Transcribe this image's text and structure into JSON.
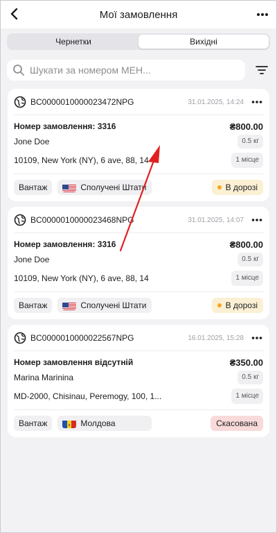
{
  "header": {
    "title": "Мої замовлення"
  },
  "tabs": [
    {
      "label": "Чернетки",
      "active": false
    },
    {
      "label": "Вихідні",
      "active": true
    }
  ],
  "search": {
    "placeholder": "Шукати за номером МЕН...",
    "value": ""
  },
  "colors": {
    "accent_arrow": "#e02020",
    "transit_bg": "#fbf0d4",
    "cancel_bg": "#f9dada"
  },
  "orders": [
    {
      "code": "BC0000010000023472NPG",
      "date": "31.01.2025, 14:24",
      "order_label": "Номер замовлення: 3316",
      "price": "₴800.00",
      "recipient": "Jone Doe",
      "weight": "0.5 кг",
      "address": "10109, New York (NY), 6 ave, 88, 14",
      "places": "1 місце",
      "type": "Вантаж",
      "country": "Сполучені Штати Америки",
      "country_flag": "us-flag-icon",
      "status": "В дорозі",
      "status_kind": "transit"
    },
    {
      "code": "BC0000010000023468NPG",
      "date": "31.01.2025, 14:07",
      "order_label": "Номер замовлення: 3316",
      "price": "₴800.00",
      "recipient": "Jone Doe",
      "weight": "0.5 кг",
      "address": "10109, New York (NY), 6 ave, 88, 14",
      "places": "1 місце",
      "type": "Вантаж",
      "country": "Сполучені Штати Америки",
      "country_flag": "us-flag-icon",
      "status": "В дорозі",
      "status_kind": "transit"
    },
    {
      "code": "BC0000010000022567NPG",
      "date": "16.01.2025, 15:28",
      "order_label": "Номер замовлення відсутній",
      "price": "₴350.00",
      "recipient": "Marina Marinina",
      "weight": "0.5 кг",
      "address": "MD-2000, Chisinau, Peremogy, 100, 1...",
      "places": "1 місце",
      "type": "Вантаж",
      "country": "Молдова",
      "country_flag": "md-flag-icon",
      "status": "Скасована",
      "status_kind": "cancel"
    }
  ]
}
